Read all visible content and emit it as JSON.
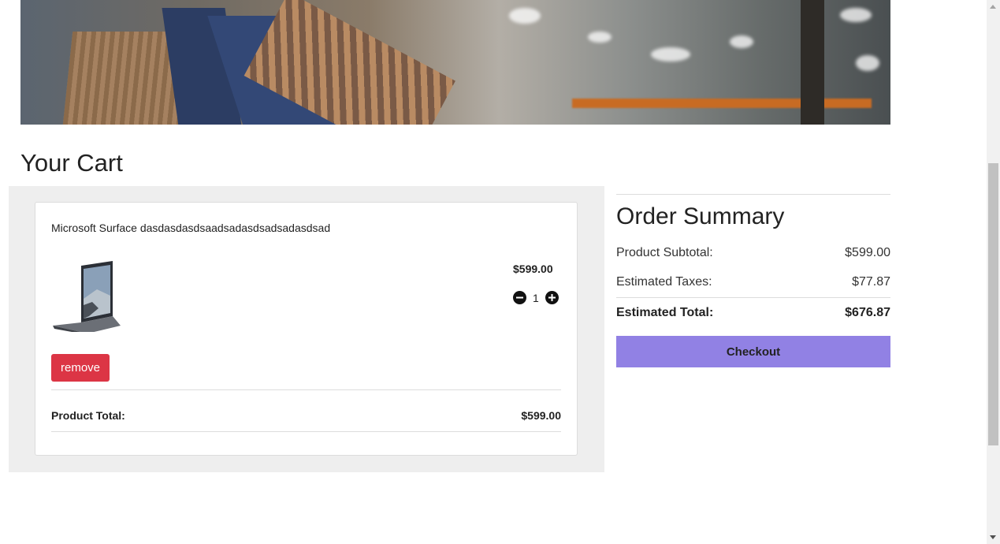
{
  "hero": {
    "image": "shopping-bags-banner"
  },
  "cart": {
    "title": "Your Cart",
    "items": [
      {
        "name": "Microsoft Surface dasdasdasdsaadsadasdsadsadasdsad",
        "image": "laptop-image",
        "price": "$599.00",
        "quantity": "1",
        "remove_label": "remove",
        "total_label": "Product Total:",
        "total_value": "$599.00"
      }
    ]
  },
  "summary": {
    "title": "Order Summary",
    "subtotal_label": "Product Subtotal:",
    "subtotal_value": "$599.00",
    "taxes_label": "Estimated Taxes:",
    "taxes_value": "$77.87",
    "total_label": "Estimated Total:",
    "total_value": "$676.87",
    "checkout_label": "Checkout"
  },
  "colors": {
    "remove": "#dc3545",
    "checkout": "#9181e4",
    "panel": "#eeeeee"
  }
}
